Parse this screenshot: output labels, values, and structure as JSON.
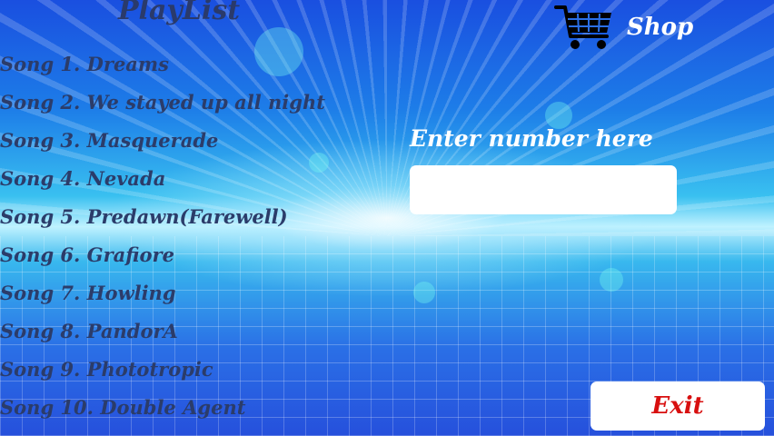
{
  "header": {
    "title": "PlayList"
  },
  "playlist": {
    "songs": [
      "Song 1. Dreams",
      "Song 2. We stayed up all night",
      "Song 3. Masquerade",
      "Song 4. Nevada",
      "Song 5. Predawn(Farewell)",
      "Song 6. Grafiore",
      "Song 7. Howling",
      "Song 8. PandorA",
      "Song 9. Phototropic",
      "Song 10. Double Agent"
    ]
  },
  "shop": {
    "label": "Shop",
    "icon": "cart-icon"
  },
  "input": {
    "prompt": "Enter number here",
    "value": "",
    "placeholder": ""
  },
  "exit": {
    "label": "Exit"
  },
  "colors": {
    "song_text": "#2b3c6a",
    "title_text": "#2a3a6b",
    "exit_text": "#d80f0f",
    "white_text": "#ffffff"
  }
}
